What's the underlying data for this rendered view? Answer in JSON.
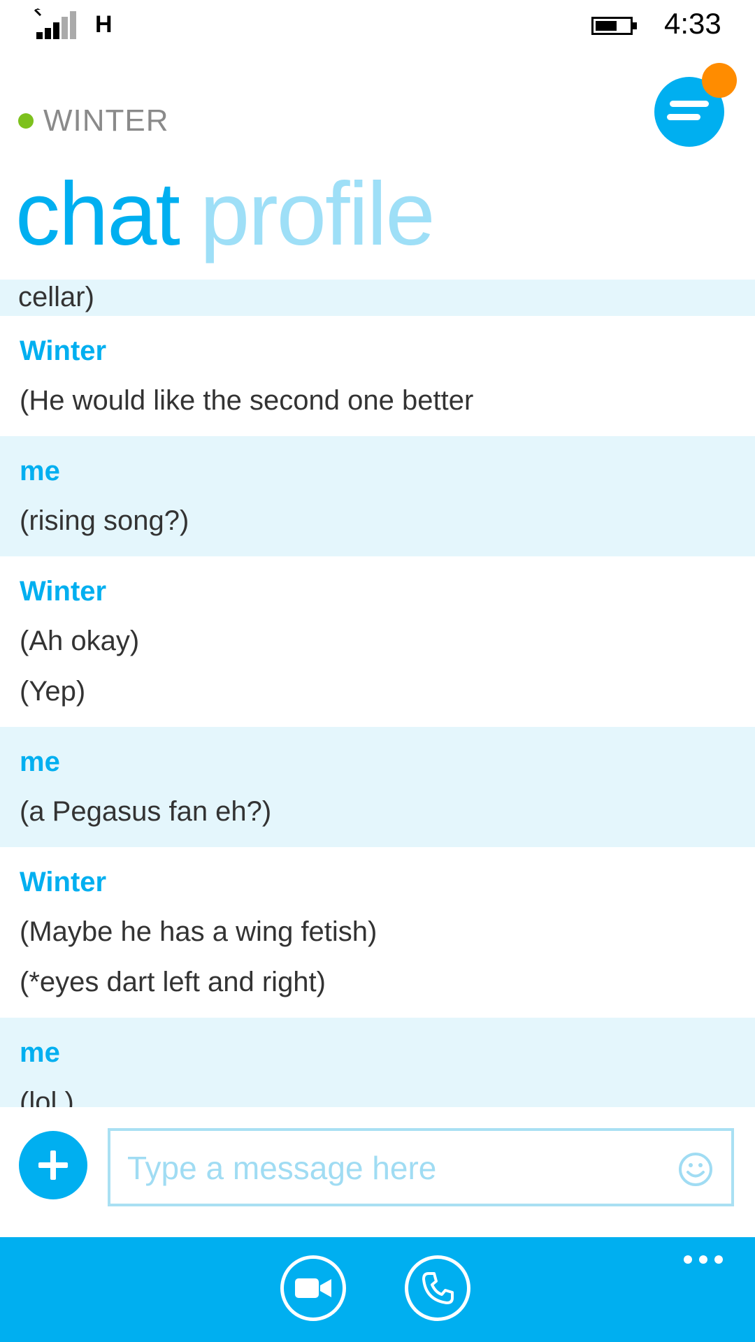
{
  "status": {
    "network": "H",
    "time": "4:33"
  },
  "header": {
    "contact_name": "WINTER",
    "tab_active": "chat",
    "tab_inactive": "profile"
  },
  "messages": [
    {
      "sender": "",
      "lines": [
        "cellar)"
      ],
      "partial": true,
      "mine": true
    },
    {
      "sender": "Winter",
      "lines": [
        "(He would like the second one better"
      ],
      "mine": false
    },
    {
      "sender": "me",
      "lines": [
        "(rising song?)"
      ],
      "mine": true
    },
    {
      "sender": "Winter",
      "lines": [
        "(Ah okay)",
        "(Yep)"
      ],
      "mine": false
    },
    {
      "sender": "me",
      "lines": [
        "(a Pegasus fan eh?)"
      ],
      "mine": true
    },
    {
      "sender": "Winter",
      "lines": [
        "(Maybe he has a wing fetish)",
        "(*eyes dart left and right)"
      ],
      "mine": false
    },
    {
      "sender": "me",
      "lines": [
        "(lol )"
      ],
      "mine": true
    }
  ],
  "composer": {
    "placeholder": "Type a message here"
  },
  "colors": {
    "accent": "#00aff0",
    "presence": "#7dc11d",
    "notification": "#ff8c00",
    "my_bubble": "#e4f6fc"
  }
}
